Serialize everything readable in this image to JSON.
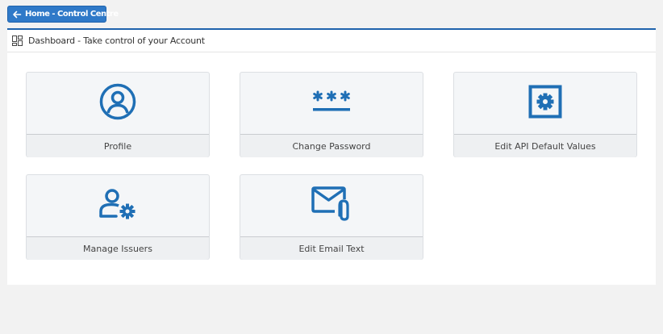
{
  "header": {
    "home_button_label": "Home - Control Centre"
  },
  "panel": {
    "title": "Dashboard - Take control of your Account"
  },
  "tiles": [
    {
      "label": "Profile",
      "icon": "user-circle-icon"
    },
    {
      "label": "Change Password",
      "icon": "password-asterisks-icon"
    },
    {
      "label": "Edit API Default Values",
      "icon": "settings-square-icon"
    },
    {
      "label": "Manage Issuers",
      "icon": "user-gear-icon"
    },
    {
      "label": "Edit Email Text",
      "icon": "mail-attachment-icon"
    }
  ],
  "colors": {
    "accent": "#1f6fb5",
    "button": "#2f79c8",
    "tile_bg": "#f4f6f8"
  }
}
